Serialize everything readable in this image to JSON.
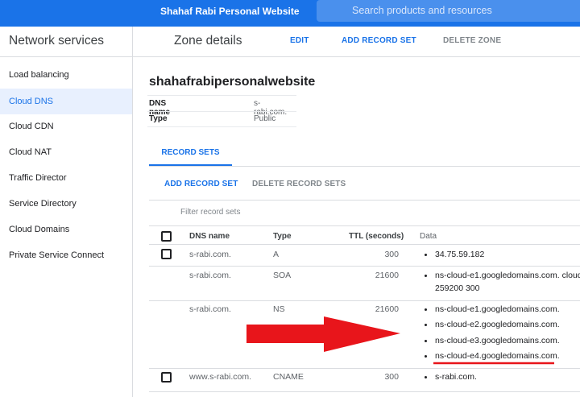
{
  "topbar": {
    "project_name": "Shahaf Rabi Personal Website",
    "search_placeholder": "Search products and resources"
  },
  "sidebar": {
    "title": "Network services",
    "items": [
      {
        "label": "Load balancing"
      },
      {
        "label": "Cloud DNS"
      },
      {
        "label": "Cloud CDN"
      },
      {
        "label": "Cloud NAT"
      },
      {
        "label": "Traffic Director"
      },
      {
        "label": "Service Directory"
      },
      {
        "label": "Cloud Domains"
      },
      {
        "label": "Private Service Connect"
      }
    ],
    "active_item": "Cloud DNS"
  },
  "header": {
    "title": "Zone details",
    "edit_label": "EDIT",
    "add_record_set_label": "ADD RECORD SET",
    "delete_zone_label": "DELETE ZONE"
  },
  "zone": {
    "name": "shahafrabipersonalwebsite",
    "dns_name_key": "DNS name",
    "dns_name_value": "s-rabi.com.",
    "type_key": "Type",
    "type_value": "Public"
  },
  "tabs": {
    "record_sets": "RECORD SETS"
  },
  "record_actions": {
    "add": "ADD RECORD SET",
    "delete": "DELETE RECORD SETS"
  },
  "filter_placeholder": "Filter record sets",
  "table": {
    "columns": {
      "dns_name": "DNS name",
      "type": "Type",
      "ttl": "TTL (seconds)",
      "data": "Data"
    },
    "rows": [
      {
        "dns_name": "s-rabi.com.",
        "type": "A",
        "ttl": "300",
        "data": [
          "34.75.59.182"
        ]
      },
      {
        "dns_name": "s-rabi.com.",
        "type": "SOA",
        "ttl": "21600",
        "data": [
          "ns-cloud-e1.googledomains.com. cloud",
          "259200 300"
        ]
      },
      {
        "dns_name": "s-rabi.com.",
        "type": "NS",
        "ttl": "21600",
        "data": [
          "ns-cloud-e1.googledomains.com.",
          "ns-cloud-e2.googledomains.com.",
          "ns-cloud-e3.googledomains.com.",
          "ns-cloud-e4.googledomains.com."
        ]
      },
      {
        "dns_name": "www.s-rabi.com.",
        "type": "CNAME",
        "ttl": "300",
        "data": [
          "s-rabi.com."
        ]
      }
    ]
  },
  "annotation": {
    "arrow_color": "#e8151b",
    "underline_color": "#e8151b"
  },
  "colors": {
    "brand_blue": "#1a73e8",
    "active_bg": "#e8f0fe"
  }
}
